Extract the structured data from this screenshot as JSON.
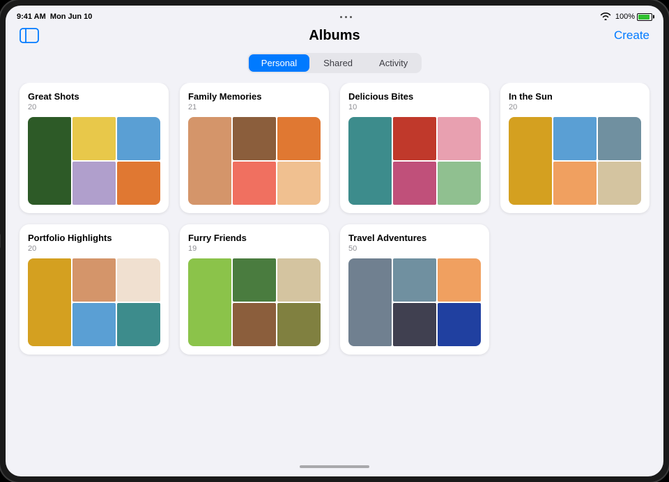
{
  "device": {
    "time": "9:41 AM",
    "date": "Mon Jun 10",
    "battery_pct": "100%",
    "wifi": true
  },
  "header": {
    "title": "Albums",
    "create_label": "Create",
    "sidebar_icon": "sidebar-icon"
  },
  "tabs": [
    {
      "id": "personal",
      "label": "Personal",
      "active": true
    },
    {
      "id": "shared",
      "label": "Shared",
      "active": false
    },
    {
      "id": "activity",
      "label": "Activity",
      "active": false
    }
  ],
  "albums": [
    {
      "id": "great-shots",
      "title": "Great Shots",
      "count": "20",
      "thumbs": [
        {
          "color": "c-forest",
          "span": "tall"
        },
        {
          "color": "c-yellow"
        },
        {
          "color": "c-blue-sky"
        },
        {
          "color": "c-lavender"
        },
        {
          "color": "c-orange"
        }
      ]
    },
    {
      "id": "family-memories",
      "title": "Family Memories",
      "count": "21",
      "thumbs": [
        {
          "color": "c-warm",
          "span": "tall"
        },
        {
          "color": "c-brown"
        },
        {
          "color": "c-orange"
        },
        {
          "color": "c-coral"
        },
        {
          "color": "c-peach"
        }
      ]
    },
    {
      "id": "delicious-bites",
      "title": "Delicious Bites",
      "count": "10",
      "thumbs": [
        {
          "color": "c-teal",
          "span": "tall"
        },
        {
          "color": "c-red"
        },
        {
          "color": "c-pink"
        },
        {
          "color": "c-magenta"
        },
        {
          "color": "c-mint"
        }
      ]
    },
    {
      "id": "in-the-sun",
      "title": "In the Sun",
      "count": "20",
      "thumbs": [
        {
          "color": "c-golden",
          "span": "tall"
        },
        {
          "color": "c-blue-sky"
        },
        {
          "color": "c-steel"
        },
        {
          "color": "c-sunset"
        },
        {
          "color": "c-sand"
        }
      ]
    },
    {
      "id": "portfolio-highlights",
      "title": "Portfolio Highlights",
      "count": "20",
      "thumbs": [
        {
          "color": "c-golden",
          "span": "tall"
        },
        {
          "color": "c-warm"
        },
        {
          "color": "c-pale"
        },
        {
          "color": "c-blue-sky"
        },
        {
          "color": "c-teal"
        }
      ]
    },
    {
      "id": "furry-friends",
      "title": "Furry Friends",
      "count": "19",
      "thumbs": [
        {
          "color": "c-lime",
          "span": "tall"
        },
        {
          "color": "c-green"
        },
        {
          "color": "c-sand"
        },
        {
          "color": "c-brown"
        },
        {
          "color": "c-olive"
        }
      ]
    },
    {
      "id": "travel-adventures",
      "title": "Travel Adventures",
      "count": "50",
      "thumbs": [
        {
          "color": "c-slate",
          "span": "tall"
        },
        {
          "color": "c-steel"
        },
        {
          "color": "c-sunset"
        },
        {
          "color": "c-charcoal"
        },
        {
          "color": "c-deep-blue"
        }
      ]
    }
  ]
}
